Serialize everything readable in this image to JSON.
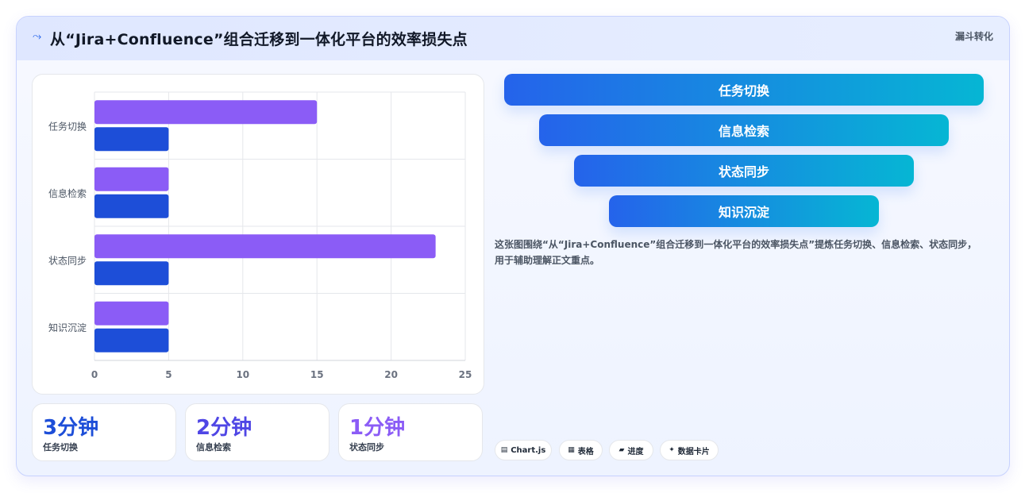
{
  "header": {
    "title": "从“Jira+Confluence”组合迁移到一体化平台的效率损失点",
    "tag": "漏斗转化",
    "icon": "trend-icon"
  },
  "chart_data": {
    "type": "bar",
    "orientation": "horizontal",
    "categories": [
      "任务切换",
      "信息检索",
      "状态同步",
      "知识沉淀"
    ],
    "series": [
      {
        "values": [
          15,
          5,
          23,
          5
        ],
        "color": "#8b5cf6"
      },
      {
        "values": [
          5,
          5,
          5,
          5
        ],
        "color": "#1d4ed8"
      }
    ],
    "xlim": [
      0,
      25
    ],
    "xticks": [
      0,
      5,
      10,
      15,
      20,
      25
    ],
    "grid": true,
    "legend": "none"
  },
  "kpis": [
    {
      "value": "3分钟",
      "label": "任务切换",
      "color": "#1d4ed8"
    },
    {
      "value": "2分钟",
      "label": "信息检索",
      "color": "#4f46e5"
    },
    {
      "value": "1分钟",
      "label": "状态同步",
      "color": "#8b5cf6"
    }
  ],
  "funnel": [
    "任务切换",
    "信息检索",
    "状态同步",
    "知识沉淀"
  ],
  "description": "这张图围绕“从“Jira+Confluence”组合迁移到一体化平台的效率损失点”提炼任务切换、信息检索、状态同步，用于辅助理解正文重点。",
  "pills": [
    {
      "icon": "chart-icon",
      "glyph": "▤",
      "label": "Chart.js"
    },
    {
      "icon": "table-icon",
      "glyph": "▦",
      "label": "表格"
    },
    {
      "icon": "progress-icon",
      "glyph": "▰",
      "label": "进度"
    },
    {
      "icon": "sparkle-icon",
      "glyph": "✦",
      "label": "数据卡片"
    }
  ]
}
